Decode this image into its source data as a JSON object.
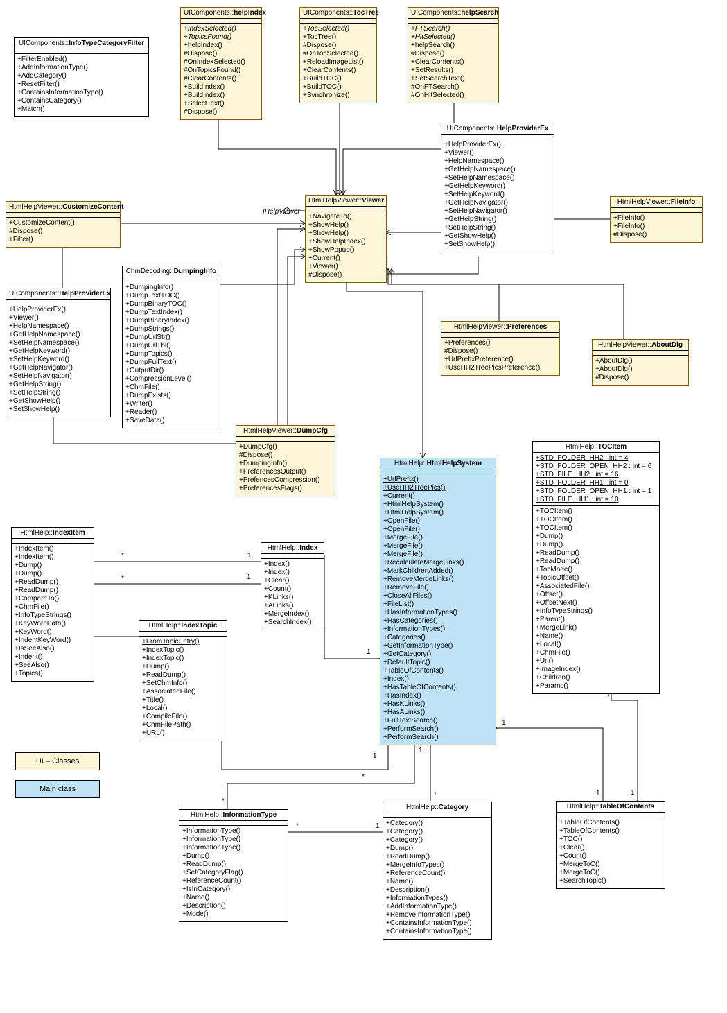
{
  "classes": {
    "infoTypeCategoryFilter": {
      "ns": "UIComponents::",
      "name": "InfoTypeCategoryFilter",
      "methods": [
        "+FilterEnabled()",
        "+AddInformationType()",
        "+AddCategory()",
        "+ResetFilter()",
        "+ContainsInformationType()",
        "+ContainsCategory()",
        "+Match()"
      ]
    },
    "helpIndex": {
      "ns": "UIComponents::",
      "name": "helpIndex",
      "methods": [
        "+IndexSelected()",
        "+TopicsFound()",
        "+helpIndex()",
        "#Dispose()",
        "#OnIndexSelected()",
        "#OnTopicsFound()",
        "#ClearContents()",
        "+BuildIndex()",
        "+BuildIndex()",
        "+SelectText()",
        "#Dispose()"
      ],
      "italics": [
        0,
        1
      ]
    },
    "tocTree": {
      "ns": "UIComponents::",
      "name": "TocTree",
      "methods": [
        "+TocSelected()",
        "+TocTree()",
        "#Dispose()",
        "#OnTocSelected()",
        "+ReloadImageList()",
        "+ClearContents()",
        "+BuildTOC()",
        "+BuildTOC()",
        "+Synchronize()"
      ],
      "italics": [
        0
      ]
    },
    "helpSearch": {
      "ns": "UIComponents::",
      "name": "helpSearch",
      "methods": [
        "+FTSearch()",
        "+HitSelected()",
        "+helpSearch()",
        "#Dispose()",
        "+ClearContents()",
        "+SetResults()",
        "+SetSearchText()",
        "#OnFTSearch()",
        "#OnHitSelected()"
      ],
      "italics": [
        0,
        1
      ]
    },
    "helpProviderExRight": {
      "ns": "UIComponents::",
      "name": "HelpProviderEx",
      "methods": [
        "+HelpProviderEx()",
        "+Viewer()",
        "+HelpNamespace()",
        "+GetHelpNamespace()",
        "+SetHelpNamespace()",
        "+GetHelpKeyword()",
        "+SetHelpKeyword()",
        "+GetHelpNavigator()",
        "+SetHelpNavigator()",
        "+GetHelpString()",
        "+SetHelpString()",
        "+GetShowHelp()",
        "+SetShowHelp()"
      ]
    },
    "fileInfo": {
      "ns": "HtmlHelpViewer::",
      "name": "FileInfo",
      "methods": [
        "+FileInfo()",
        "+FileInfo()",
        "#Dispose()"
      ]
    },
    "customizeContent": {
      "ns": "HtmlHelpViewer::",
      "name": "CustomizeContent",
      "methods": [
        "+CustomizeContent()",
        "#Dispose()",
        "+Filter()"
      ]
    },
    "viewer": {
      "ns": "HtmlHelpViewer::",
      "name": "Viewer",
      "methods": [
        "+NavigateTo()",
        "+ShowHelp()",
        "+ShowHelp()",
        "+ShowHelpIndex()",
        "+ShowPopup()",
        "+Current()",
        "+Viewer()",
        "#Dispose()"
      ],
      "underlines": [
        5
      ]
    },
    "helpProviderExLeft": {
      "ns": "UIComponents::",
      "name": "HelpProviderEx",
      "methods": [
        "+HelpProviderEx()",
        "+Viewer()",
        "+HelpNamespace()",
        "+GetHelpNamespace()",
        "+SetHelpNamespace()",
        "+GetHelpKeyword()",
        "+SetHelpKeyword()",
        "+GetHelpNavigator()",
        "+SetHelpNavigator()",
        "+GetHelpString()",
        "+SetHelpString()",
        "+GetShowHelp()",
        "+SetShowHelp()"
      ]
    },
    "dumpingInfo": {
      "ns": "ChmDecoding::",
      "name": "DumpingInfo",
      "methods": [
        "+DumpingInfo()",
        "+DumpTextTOC()",
        "+DumpBinaryTOC()",
        "+DumpTextIndex()",
        "+DumpBinaryIndex()",
        "+DumpStrings()",
        "+DumpUrlStr()",
        "+DumpUrlTbl()",
        "+DumpTopics()",
        "+DumpFullText()",
        "+OutputDir()",
        "+CompressionLevel()",
        "+ChmFile()",
        "+DumpExists()",
        "+Writer()",
        "+Reader()",
        "+SaveData()"
      ]
    },
    "preferences": {
      "ns": "HtmlHelpViewer::",
      "name": "Preferences",
      "methods": [
        "+Preferences()",
        "#Dispose()",
        "+UrlPrefixPreference()",
        "+UseHH2TreePicsPreference()"
      ]
    },
    "aboutDlg": {
      "ns": "HtmlHelpViewer::",
      "name": "AboutDlg",
      "methods": [
        "+AboutDlg()",
        "+AboutDlg()",
        "#Dispose()"
      ]
    },
    "dumpCfg": {
      "ns": "HtmlHelpViewer::",
      "name": "DumpCfg",
      "methods": [
        "+DumpCfg()",
        "#Dispose()",
        "+DumpingInfo()",
        "+PreferencesOutput()",
        "+PrefencesCompression()",
        "+PreferencesFlags()"
      ]
    },
    "htmlHelpSystem": {
      "ns": "HtmlHelp::",
      "name": "HtmlHelpSystem",
      "methods": [
        "+UrlPrefix()",
        "+UseHH2TreePics()",
        "+Current()",
        "+HtmlHelpSystem()",
        "+HtmlHelpSystem()",
        "+OpenFile()",
        "+OpenFile()",
        "+MergeFile()",
        "+MergeFile()",
        "+MergeFile()",
        "+RecalculateMergeLinks()",
        "+MarkChildrenAdded()",
        "+RemoveMergeLinks()",
        "+RemoveFile()",
        "+CloseAllFiles()",
        "+FileList()",
        "+HasInformationTypes()",
        "+HasCategories()",
        "+InformationTypes()",
        "+Categories()",
        "+GetInformationType()",
        "+GetCategory()",
        "+DefaultTopic()",
        "+TableOfContents()",
        "+Index()",
        "+HasTableOfContents()",
        "+HasIndex()",
        "+HasKLinks()",
        "+HasALinks()",
        "+FullTextSearch()",
        "+PerformSearch()",
        "+PerformSearch()"
      ],
      "underlines": [
        0,
        1,
        2
      ]
    },
    "tocItem": {
      "ns": "HtmlHelp::",
      "name": "TOCItem",
      "attrs": [
        "+STD_FOLDER_HH2 : int = 4",
        "+STD_FOLDER_OPEN_HH2 : int = 6",
        "+STD_FILE_HH2 : int = 16",
        "+STD_FOLDER_HH1 : int = 0",
        "+STD_FOLDER_OPEN_HH1 : int = 1",
        "+STD_FILE_HH1 : int = 10"
      ],
      "methods": [
        "+TOCItem()",
        "+TOCItem()",
        "+TOCItem()",
        "+Dump()",
        "+Dump()",
        "+ReadDump()",
        "+ReadDump()",
        "+TocMode()",
        "+TopicOffset()",
        "+AssociatedFile()",
        "+Offset()",
        "+OffsetNext()",
        "+InfoTypeStrings()",
        "+Parent()",
        "+MergeLink()",
        "+Name()",
        "+Local()",
        "+ChmFile()",
        "+Url()",
        "+ImageIndex()",
        "+Children()",
        "+Params()"
      ]
    },
    "indexItem": {
      "ns": "HtmlHelp::",
      "name": "IndexItem",
      "methods": [
        "+IndexItem()",
        "+IndexItem()",
        "+Dump()",
        "+Dump()",
        "+ReadDump()",
        "+ReadDump()",
        "+CompareTo()",
        "+ChmFile()",
        "+InfoTypeStrings()",
        "+KeyWordPath()",
        "+KeyWord()",
        "+IndentKeyWord()",
        "+IsSeeAlso()",
        "+Indent()",
        "+SeeAlso()",
        "+Topics()"
      ]
    },
    "index": {
      "ns": "HtmlHelp::",
      "name": "Index",
      "methods": [
        "+Index()",
        "+Index()",
        "+Clear()",
        "+Count()",
        "+KLinks()",
        "+ALinks()",
        "+MergeIndex()",
        "+SearchIndex()"
      ]
    },
    "indexTopic": {
      "ns": "HtmlHelp::",
      "name": "IndexTopic",
      "methods": [
        "+FromTopicEntry()",
        "+IndexTopic()",
        "+IndexTopic()",
        "+Dump()",
        "+ReadDump()",
        "+SetChmInfo()",
        "+AssociatedFile()",
        "+Title()",
        "+Local()",
        "+CompileFile()",
        "+ChmFilePath()",
        "+URL()"
      ],
      "underlines": [
        0
      ]
    },
    "informationType": {
      "ns": "HtmlHelp::",
      "name": "InformationType",
      "methods": [
        "+InformationType()",
        "+InformationType()",
        "+InformationType()",
        "+Dump()",
        "+ReadDump()",
        "+SetCategoryFlag()",
        "+ReferenceCount()",
        "+IsInCategory()",
        "+Name()",
        "+Description()",
        "+Mode()"
      ]
    },
    "category": {
      "ns": "HtmlHelp::",
      "name": "Category",
      "methods": [
        "+Category()",
        "+Category()",
        "+Category()",
        "+Dump()",
        "+ReadDump()",
        "+MergeInfoTypes()",
        "+ReferenceCount()",
        "+Name()",
        "+Description()",
        "+InformationTypes()",
        "+AddInformationType()",
        "+RemoveInformationType()",
        "+ContainsInformationType()",
        "+ContainsInformationType()"
      ]
    },
    "tableOfContents": {
      "ns": "HtmlHelp::",
      "name": "TableOfContents",
      "methods": [
        "+TableOfContents()",
        "+TableOfContents()",
        "+TOC()",
        "+Clear()",
        "+Count()",
        "+MergeToC()",
        "+MergeToC()",
        "+SearchTopic()"
      ]
    }
  },
  "labels": {
    "ihelpViewer": "IHelpViewer",
    "one": "1",
    "star": "*"
  },
  "legend": {
    "ui": "UI – Classes",
    "main": "Main class"
  }
}
